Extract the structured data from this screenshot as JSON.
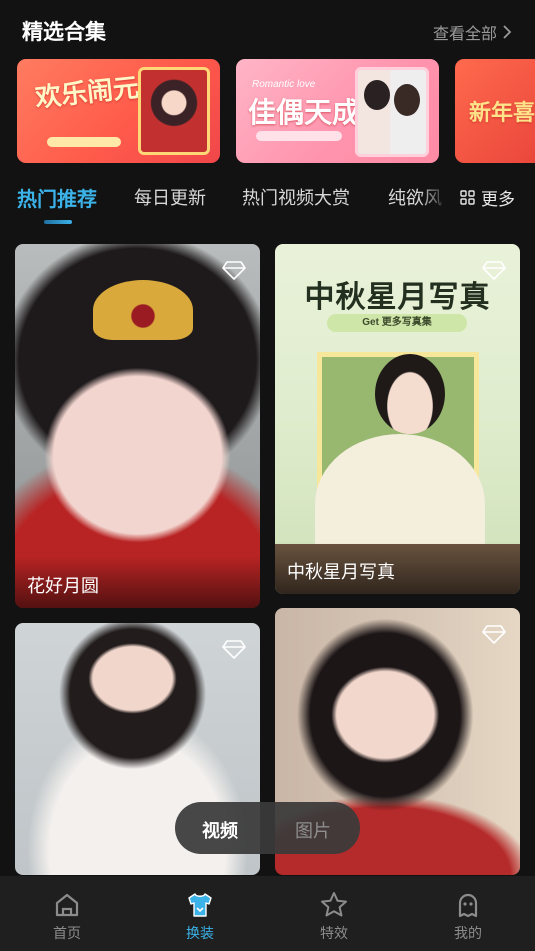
{
  "header": {
    "title": "精选合集",
    "view_all": "查看全部"
  },
  "banners": [
    {
      "title": "欢乐闹元宵"
    },
    {
      "title": "佳偶天成",
      "subtitle": "Romantic love"
    },
    {
      "title": "新年喜"
    }
  ],
  "tabs": [
    {
      "label": "热门推荐",
      "active": true
    },
    {
      "label": "每日更新"
    },
    {
      "label": "热门视频大赏"
    },
    {
      "label": "纯欲风"
    }
  ],
  "more_label": "更多",
  "cards": [
    {
      "label": "花好月圆"
    },
    {
      "label": "中秋星月写真",
      "poster_title": "中秋星月写真",
      "poster_sub": "Get 更多写真集"
    },
    {
      "label": ""
    },
    {
      "label": ""
    }
  ],
  "media_switch": {
    "video": "视频",
    "image": "图片",
    "selected": "视频"
  },
  "nav": [
    {
      "label": "首页",
      "icon": "home-icon"
    },
    {
      "label": "换装",
      "icon": "tshirt-icon",
      "active": true
    },
    {
      "label": "特效",
      "icon": "star-icon"
    },
    {
      "label": "我的",
      "icon": "profile-icon"
    }
  ],
  "colors": {
    "accent": "#3bb2e8",
    "background": "#121212",
    "nav_bg": "#1f1f1f"
  }
}
